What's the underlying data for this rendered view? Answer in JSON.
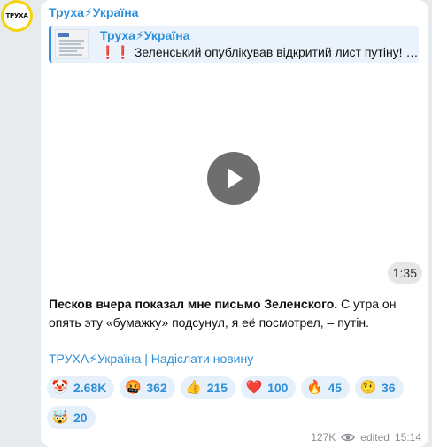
{
  "channel": {
    "avatar_text": "ТРУХА",
    "name": "Труха⚡Україна"
  },
  "reply": {
    "name": "Труха⚡Україна",
    "excl": "❗❗",
    "text": "Зеленський опублікував відкритий лист путіну! …"
  },
  "video": {
    "duration": "1:35"
  },
  "message": {
    "bold": "Песков вчера показал мне письмо Зеленского.",
    "rest": " С утра он опять эту «бумажку» подсунул, я её посмотрел, – путін.",
    "links": "ТРУХА⚡Україна | Надіслати новину"
  },
  "reactions": [
    {
      "emoji": "🤡",
      "icon": "clown-face-icon",
      "count": "2.68K"
    },
    {
      "emoji": "🤬",
      "icon": "cursing-face-icon",
      "count": "362"
    },
    {
      "emoji": "👍",
      "icon": "thumbs-up-icon",
      "count": "215"
    },
    {
      "emoji": "❤️",
      "icon": "red-heart-icon",
      "count": "100"
    },
    {
      "emoji": "🔥",
      "icon": "fire-icon",
      "count": "45"
    },
    {
      "emoji": "🤨",
      "icon": "raised-eyebrow-face-icon",
      "count": "36"
    },
    {
      "emoji": "🤯",
      "icon": "exploding-head-icon",
      "count": "20"
    }
  ],
  "meta": {
    "views": "127K",
    "edited": "edited",
    "time": "15:14"
  },
  "colors": {
    "accent": "#2f8fd8",
    "background": "#e7ebee",
    "avatar_ring": "#f5d20a"
  }
}
